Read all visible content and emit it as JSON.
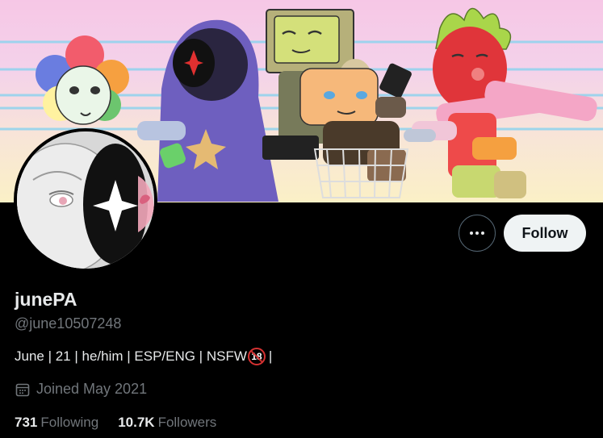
{
  "profile": {
    "display_name": "junePA",
    "handle": "@june10507248",
    "bio_prefix": "June | 21 | he/him | ESP/ENG | NSFW",
    "bio_badge": "18",
    "bio_suffix": "|",
    "joined": "Joined May 2021",
    "following_count": "731",
    "following_label": "Following",
    "followers_count": "10.7K",
    "followers_label": "Followers"
  },
  "actions": {
    "follow_label": "Follow",
    "more_icon": "more-horizontal-icon"
  },
  "icons": {
    "joined": "calendar-icon",
    "badge": "no-under-18-icon"
  },
  "colors": {
    "background": "#000000",
    "primary_text": "#e7e9ea",
    "secondary_text": "#71767b",
    "follow_bg": "#eff3f4",
    "badge_red": "#d63232"
  }
}
